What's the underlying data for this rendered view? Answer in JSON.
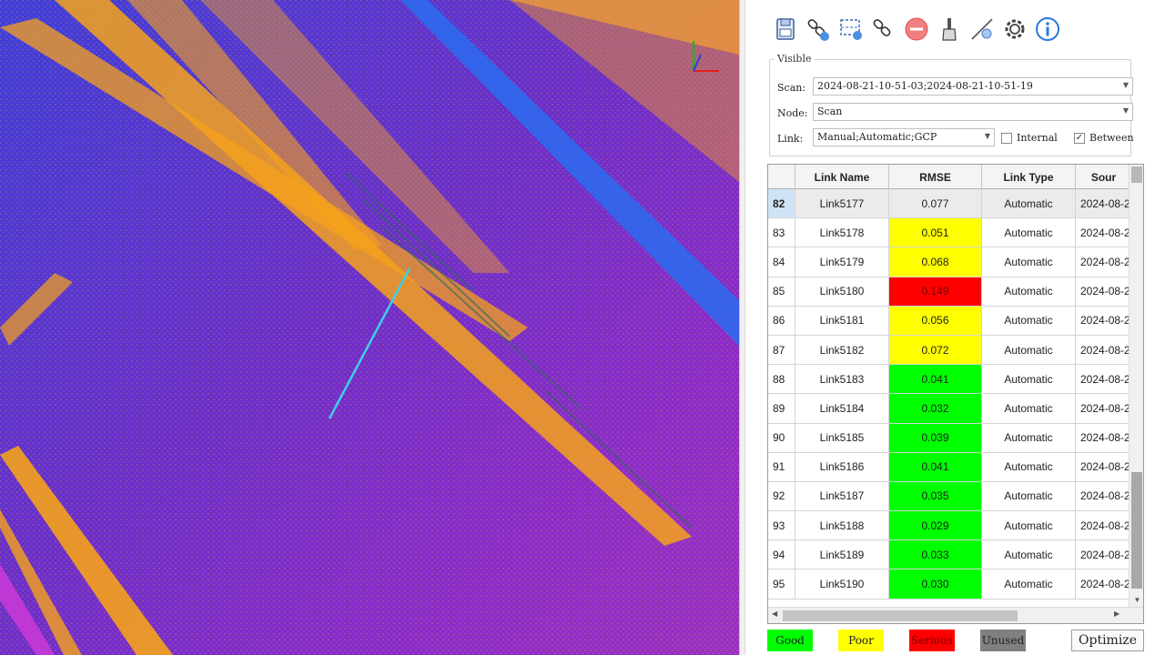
{
  "toolbar": {
    "buttons": [
      {
        "name": "save-icon"
      },
      {
        "name": "auto-link-icon"
      },
      {
        "name": "grid-link-icon"
      },
      {
        "name": "link-edit-icon"
      },
      {
        "name": "remove-icon"
      },
      {
        "name": "brush-icon"
      },
      {
        "name": "line-tool-icon"
      },
      {
        "name": "settings-icon"
      },
      {
        "name": "info-icon"
      }
    ]
  },
  "visible": {
    "legend": "Visible",
    "scan_label": "Scan:",
    "scan_value": "2024-08-21-10-51-03;2024-08-21-10-51-19",
    "node_label": "Node:",
    "node_value": "Scan",
    "link_label": "Link:",
    "link_value": "Manual;Automatic;GCP",
    "internal_label": "Internal",
    "internal_checked": false,
    "between_label": "Between",
    "between_checked": true,
    "between_mark": "✓"
  },
  "grid": {
    "headers": [
      "",
      "Link Name",
      "RMSE",
      "Link Type",
      "Sour"
    ],
    "rows": [
      {
        "num": "82",
        "name": "Link5177",
        "rmse": "0.077",
        "type": "Automatic",
        "source": "2024-08-2",
        "color": "#ebebeb"
      },
      {
        "num": "83",
        "name": "Link5178",
        "rmse": "0.051",
        "type": "Automatic",
        "source": "2024-08-2",
        "color": "#ffff00"
      },
      {
        "num": "84",
        "name": "Link5179",
        "rmse": "0.068",
        "type": "Automatic",
        "source": "2024-08-2",
        "color": "#ffff00"
      },
      {
        "num": "85",
        "name": "Link5180",
        "rmse": "0.149",
        "type": "Automatic",
        "source": "2024-08-2",
        "color": "#ff0000"
      },
      {
        "num": "86",
        "name": "Link5181",
        "rmse": "0.056",
        "type": "Automatic",
        "source": "2024-08-2",
        "color": "#ffff00"
      },
      {
        "num": "87",
        "name": "Link5182",
        "rmse": "0.072",
        "type": "Automatic",
        "source": "2024-08-2",
        "color": "#ffff00"
      },
      {
        "num": "88",
        "name": "Link5183",
        "rmse": "0.041",
        "type": "Automatic",
        "source": "2024-08-2",
        "color": "#00ff00"
      },
      {
        "num": "89",
        "name": "Link5184",
        "rmse": "0.032",
        "type": "Automatic",
        "source": "2024-08-2",
        "color": "#00ff00"
      },
      {
        "num": "90",
        "name": "Link5185",
        "rmse": "0.039",
        "type": "Automatic",
        "source": "2024-08-2",
        "color": "#00ff00"
      },
      {
        "num": "91",
        "name": "Link5186",
        "rmse": "0.041",
        "type": "Automatic",
        "source": "2024-08-2",
        "color": "#00ff00"
      },
      {
        "num": "92",
        "name": "Link5187",
        "rmse": "0.035",
        "type": "Automatic",
        "source": "2024-08-2",
        "color": "#00ff00"
      },
      {
        "num": "93",
        "name": "Link5188",
        "rmse": "0.029",
        "type": "Automatic",
        "source": "2024-08-2",
        "color": "#00ff00"
      },
      {
        "num": "94",
        "name": "Link5189",
        "rmse": "0.033",
        "type": "Automatic",
        "source": "2024-08-2",
        "color": "#00ff00"
      },
      {
        "num": "95",
        "name": "Link5190",
        "rmse": "0.030",
        "type": "Automatic",
        "source": "2024-08-2",
        "color": "#00ff00"
      }
    ]
  },
  "legend": {
    "good": {
      "label": "Good",
      "color": "#00ff00"
    },
    "poor": {
      "label": "Poor",
      "color": "#ffff00"
    },
    "serious": {
      "label": "Serious",
      "color": "#ff0000"
    },
    "unused": {
      "label": "Unused",
      "color": "#808080"
    }
  },
  "optimize_label": "Optimize",
  "colors": {
    "pointcloud_bg": "#5a2fc0",
    "pointcloud_orange": "#f5a21b",
    "pointcloud_blue": "#2a6cf0",
    "link_line": "#3cd0e8",
    "selected_row": "#cfe3f5"
  }
}
